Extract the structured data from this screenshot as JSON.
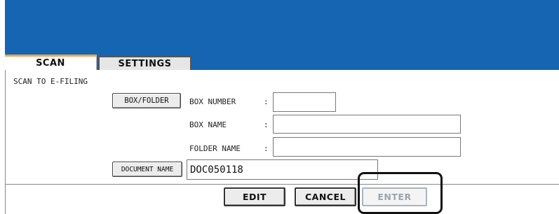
{
  "tabs": [
    {
      "label": "SCAN",
      "active": true
    },
    {
      "label": "SETTINGS",
      "active": false
    }
  ],
  "section_title": "SCAN TO E-FILING",
  "buttons": {
    "box_folder": "BOX/FOLDER",
    "document_name": "DOCUMENT NAME"
  },
  "fields": {
    "box_number": {
      "label": "BOX NUMBER",
      "colon": ":",
      "value": ""
    },
    "box_name": {
      "label": "BOX NAME",
      "colon": ":",
      "value": ""
    },
    "folder_name": {
      "label": "FOLDER NAME",
      "colon": ":",
      "value": ""
    },
    "document_name": {
      "value": "DOC050118"
    }
  },
  "actions": {
    "edit": "EDIT",
    "cancel": "CANCEL",
    "enter": "ENTER"
  },
  "colors": {
    "header_blue": "#1565b3",
    "active_tab_accent": "#f2a64a",
    "disabled_text": "#9aa4ad"
  }
}
